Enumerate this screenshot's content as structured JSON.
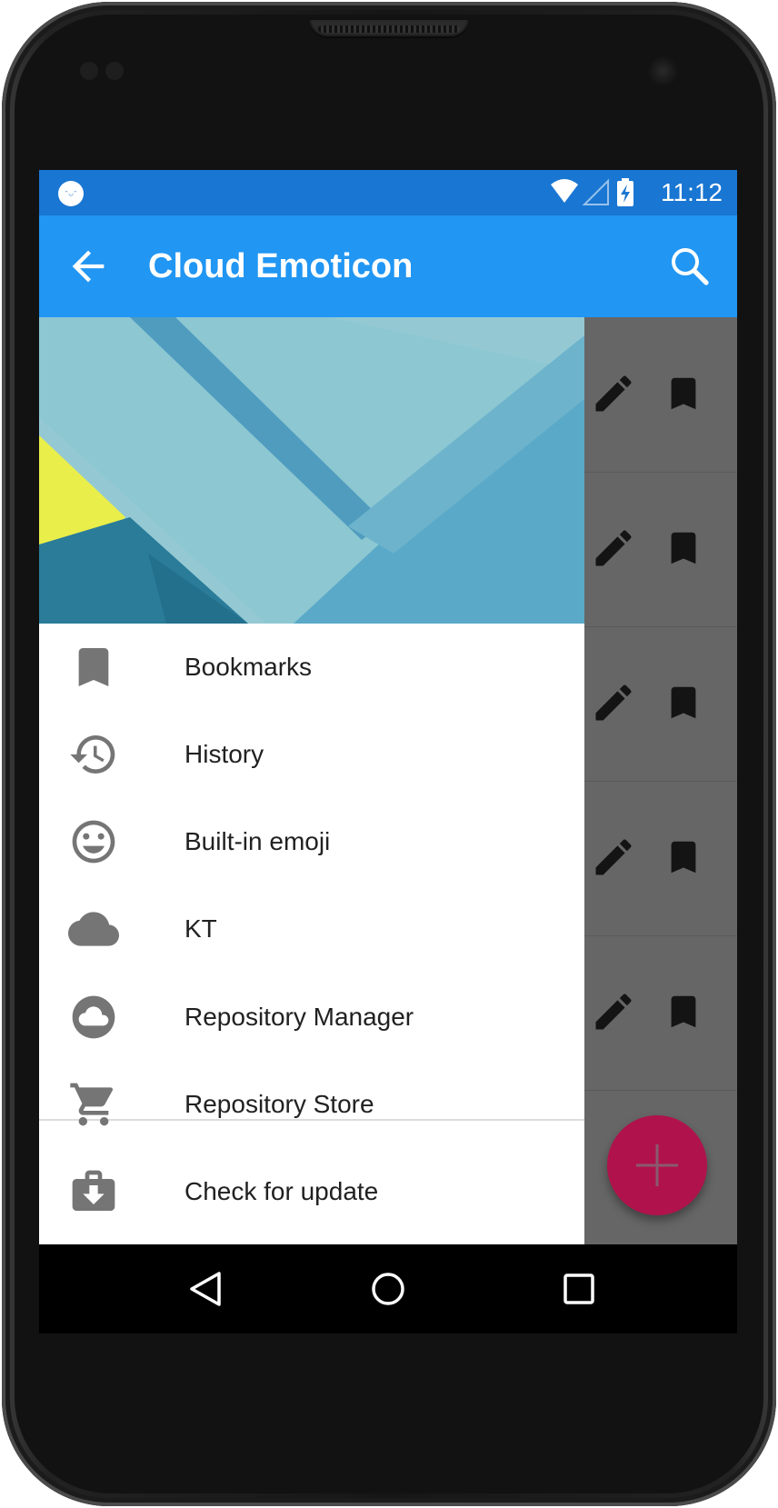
{
  "status_bar": {
    "time": "11:12",
    "app_icon_text": "ᵔ◡ᵔ",
    "icons": [
      "wifi-icon",
      "cell-signal-icon",
      "battery-charging-icon"
    ]
  },
  "app_bar": {
    "title": "Cloud Emoticon",
    "back_icon": "arrow-back-icon",
    "search_icon": "search-icon"
  },
  "drawer": {
    "items": [
      {
        "label": "Bookmarks",
        "icon": "bookmark-icon"
      },
      {
        "label": "History",
        "icon": "history-icon"
      },
      {
        "label": "Built-in emoji",
        "icon": "emoji-icon"
      },
      {
        "label": "KT",
        "icon": "cloud-icon"
      },
      {
        "label": "Repository Manager",
        "icon": "cloud-circle-icon"
      },
      {
        "label": "Repository Store",
        "icon": "shopping-cart-icon"
      },
      {
        "label": "Check for update",
        "icon": "system-update-icon"
      }
    ]
  },
  "list_row_actions": [
    "edit-icon",
    "bookmark-icon"
  ],
  "fab": {
    "icon": "add-icon"
  },
  "navigation_bar": [
    "back-nav-icon",
    "home-nav-icon",
    "recents-nav-icon"
  ],
  "colors": {
    "status_bar": "#1976d2",
    "app_bar": "#2196f3",
    "fab": "#b0134c",
    "icon_grey": "#757575"
  }
}
